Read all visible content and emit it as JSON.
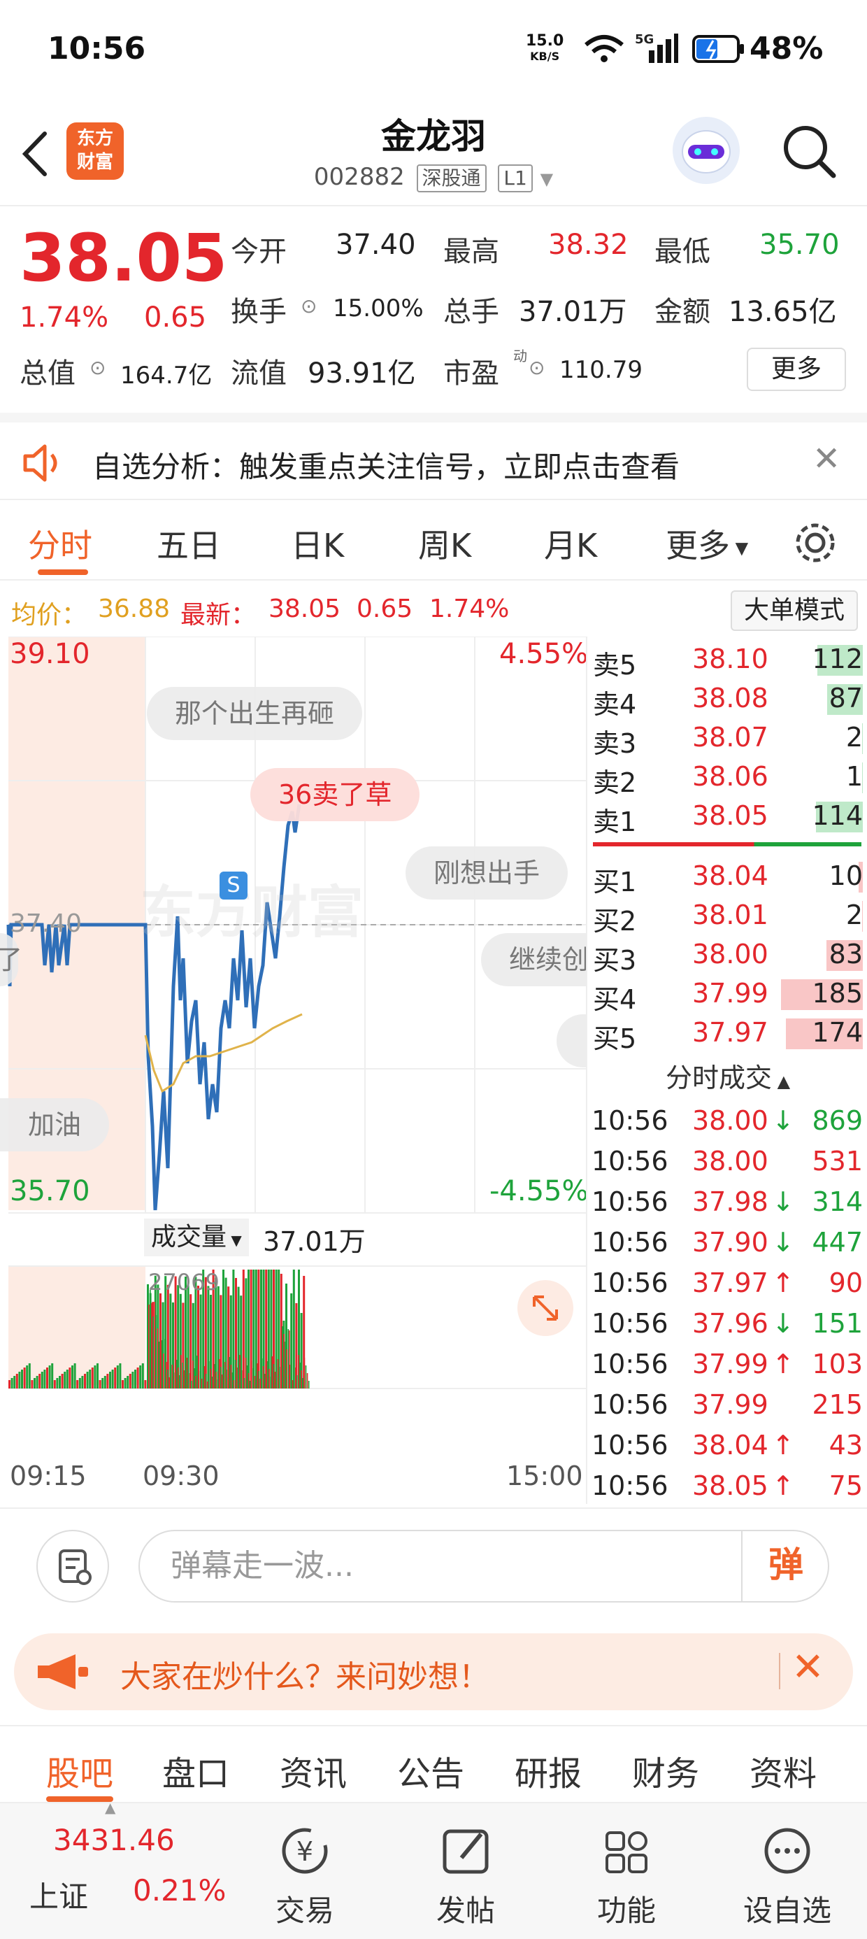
{
  "status": {
    "time": "10:56",
    "net_speed": "15.0",
    "net_unit": "KB/S",
    "net_type": "5G",
    "battery": "48%"
  },
  "header": {
    "logo_line1": "东方",
    "logo_line2": "财富",
    "title": "金龙羽",
    "code": "002882",
    "tag1": "深股通",
    "tag2": "L1"
  },
  "quote": {
    "price": "38.05",
    "pct": "1.74%",
    "change": "0.65",
    "open_label": "今开",
    "open": "37.40",
    "high_label": "最高",
    "high": "38.32",
    "low_label": "最低",
    "low": "35.70",
    "turnover_label": "换手",
    "turnover": "15.00%",
    "volume_label": "总手",
    "volume": "37.01万",
    "amount_label": "金额",
    "amount": "13.65亿",
    "mcap_label": "总值",
    "mcap": "164.7亿",
    "float_label": "流值",
    "float_mcap": "93.91亿",
    "pe_label": "市盈",
    "pe_sup": "动",
    "pe": "110.79",
    "more": "更多"
  },
  "alert": {
    "text": "自选分析：触发重点关注信号，立即点击查看"
  },
  "chart_tabs": [
    "分时",
    "五日",
    "日K",
    "周K",
    "月K",
    "更多"
  ],
  "avg": {
    "avg_label": "均价：",
    "avg": "36.88",
    "latest_label": "最新：",
    "latest": "38.05",
    "change": "0.65",
    "pct": "1.74%",
    "big_order": "大单模式"
  },
  "chart": {
    "y_top": "39.10",
    "y_bottom": "35.70",
    "pct_top": "4.55%",
    "pct_bottom": "-4.55%",
    "prev_close_label": "37.40",
    "volume_label": "成交量",
    "volume_total": "37.01万",
    "vol_max": "27069",
    "time_start": "09:15",
    "time_mid": "09:30",
    "time_end": "15:00",
    "marker": "S",
    "danmu": [
      "那个出生再砸",
      "36卖了草",
      "刚想出手",
      "继续创",
      "加油",
      "了"
    ],
    "watermark": "东方财富"
  },
  "orderbook": {
    "asks": [
      {
        "label": "卖5",
        "price": "38.10",
        "vol": "112"
      },
      {
        "label": "卖4",
        "price": "38.08",
        "vol": "87"
      },
      {
        "label": "卖3",
        "price": "38.07",
        "vol": "2"
      },
      {
        "label": "卖2",
        "price": "38.06",
        "vol": "1"
      },
      {
        "label": "卖1",
        "price": "38.05",
        "vol": "114"
      }
    ],
    "bids": [
      {
        "label": "买1",
        "price": "38.04",
        "vol": "10"
      },
      {
        "label": "买2",
        "price": "38.01",
        "vol": "2"
      },
      {
        "label": "买3",
        "price": "38.00",
        "vol": "83"
      },
      {
        "label": "买4",
        "price": "37.99",
        "vol": "185"
      },
      {
        "label": "买5",
        "price": "37.97",
        "vol": "174"
      }
    ],
    "trades_title": "分时成交",
    "trades": [
      {
        "time": "10:56",
        "price": "38.00",
        "dir": "↓",
        "vol": "869"
      },
      {
        "time": "10:56",
        "price": "38.00",
        "dir": "",
        "vol": "531"
      },
      {
        "time": "10:56",
        "price": "37.98",
        "dir": "↓",
        "vol": "314"
      },
      {
        "time": "10:56",
        "price": "37.90",
        "dir": "↓",
        "vol": "447"
      },
      {
        "time": "10:56",
        "price": "37.97",
        "dir": "↑",
        "vol": "90"
      },
      {
        "time": "10:56",
        "price": "37.96",
        "dir": "↓",
        "vol": "151"
      },
      {
        "time": "10:56",
        "price": "37.99",
        "dir": "↑",
        "vol": "103"
      },
      {
        "time": "10:56",
        "price": "37.99",
        "dir": "",
        "vol": "215"
      },
      {
        "time": "10:56",
        "price": "38.04",
        "dir": "↑",
        "vol": "43"
      },
      {
        "time": "10:56",
        "price": "38.05",
        "dir": "↑",
        "vol": "75"
      }
    ]
  },
  "danmu_bar": {
    "placeholder": "弹幕走一波...",
    "send": "弹"
  },
  "promo": {
    "text": "大家在炒什么？来问妙想！"
  },
  "bottom_tabs": [
    "股吧",
    "盘口",
    "资讯",
    "公告",
    "研报",
    "财务",
    "资料"
  ],
  "nav": {
    "index_value": "3431.46",
    "index_name": "上证",
    "index_pct": "0.21%",
    "trade": "交易",
    "post": "发帖",
    "func": "功能",
    "watch": "设自选"
  },
  "colors": {
    "up": "#e3262c",
    "down": "#1ea33b",
    "accent": "#f0632a",
    "line": "#2f6fb8",
    "avg_line": "#e0b34a"
  }
}
